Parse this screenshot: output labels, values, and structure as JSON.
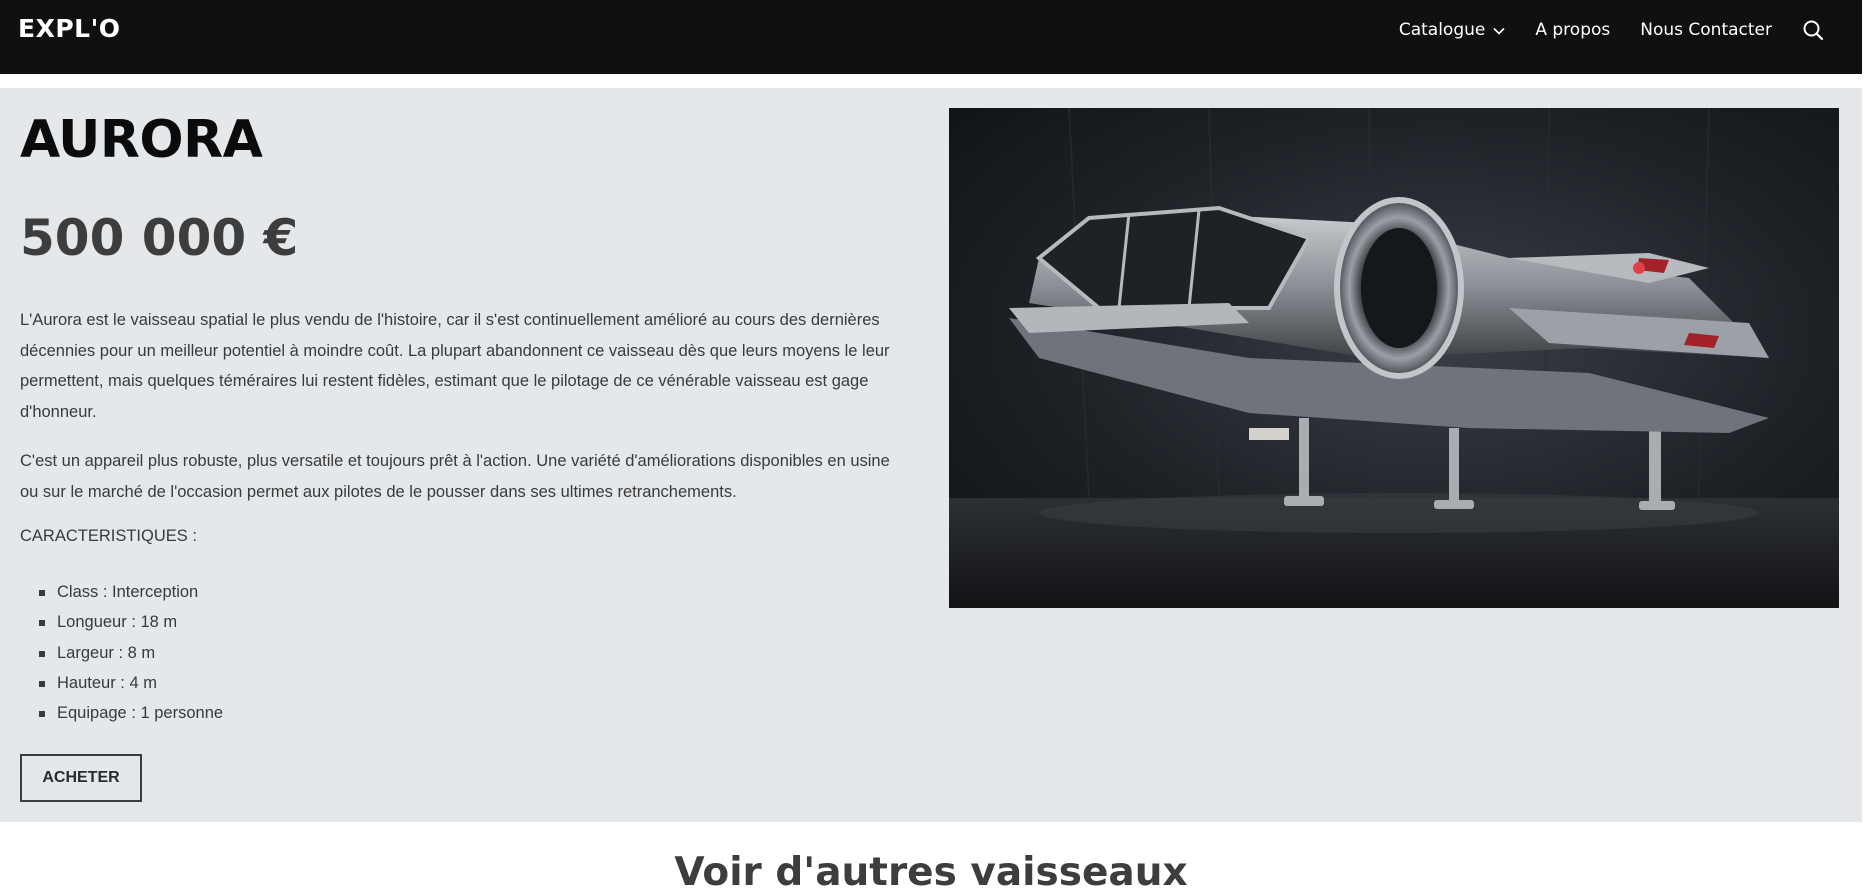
{
  "header": {
    "logo": "EXPL'O",
    "nav": {
      "catalogue": "Catalogue",
      "about": "A propos",
      "contact": "Nous Contacter"
    },
    "icons": {
      "dropdown": "chevron-down-icon",
      "search": "search-icon"
    }
  },
  "product": {
    "name": "AURORA",
    "price": "500 000 €",
    "description_1": "L'Aurora est le vaisseau spatial le plus vendu de l'histoire, car il s'est continuellement amélioré au cours des dernières décennies pour un meilleur potentiel à moindre coût. La plupart abandonnent ce vaisseau dès que leurs moyens le leur permettent, mais quelques téméraires lui restent fidèles, estimant que le pilotage de ce vénérable vaisseau est gage d'honneur.",
    "description_2": "C'est un appareil plus robuste, plus versatile et toujours prêt à l'action. Une variété d'améliorations disponibles en usine ou sur le marché de l'occasion permet aux pilotes de le pousser dans ses ultimes retranchements.",
    "specs_title": "CARACTERISTIQUES :",
    "specs": [
      "Class : Interception",
      "Longueur : 18 m",
      "Largeur : 8 m",
      "Hauteur : 4 m",
      "Equipage : 1 personne"
    ],
    "buy_label": "ACHETER"
  },
  "related": {
    "title": "Voir d'autres vaisseaux"
  },
  "colors": {
    "header_bg": "#101010",
    "section_bg": "#e4e8eb",
    "text": "#3a3a3a"
  }
}
